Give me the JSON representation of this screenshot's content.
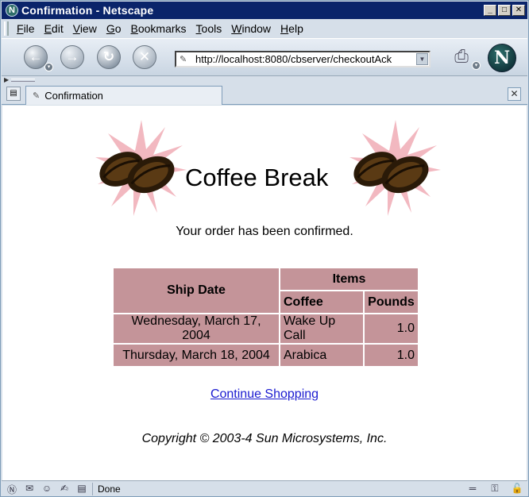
{
  "window": {
    "title": "Confirmation - Netscape",
    "controls": [
      "_",
      "□",
      "✕"
    ]
  },
  "menubar": {
    "items": [
      {
        "label": "File",
        "key": "F",
        "rest": "ile"
      },
      {
        "label": "Edit",
        "key": "E",
        "rest": "dit"
      },
      {
        "label": "View",
        "key": "V",
        "rest": "iew"
      },
      {
        "label": "Go",
        "key": "G",
        "rest": "o"
      },
      {
        "label": "Bookmarks",
        "key": "B",
        "rest": "ookmarks"
      },
      {
        "label": "Tools",
        "key": "T",
        "rest": "ools"
      },
      {
        "label": "Window",
        "key": "W",
        "rest": "indow"
      },
      {
        "label": "Help",
        "key": "H",
        "rest": "elp"
      }
    ]
  },
  "toolbar": {
    "back_icon": "back-arrow-icon",
    "forward_icon": "forward-arrow-icon",
    "reload_icon": "reload-icon",
    "stop_icon": "stop-icon",
    "url": "http://localhost:8080/cbserver/checkoutAck",
    "logo_letter": "N"
  },
  "tabs": [
    {
      "label": "Confirmation"
    }
  ],
  "page": {
    "brand_title": "Coffee Break",
    "confirm_message": "Your order has been confirmed.",
    "table": {
      "header_ship_date": "Ship Date",
      "header_items": "Items",
      "header_coffee": "Coffee",
      "header_pounds": "Pounds",
      "rows": [
        {
          "date": "Wednesday, March 17, 2004",
          "coffee": "Wake Up Call",
          "pounds": "1.0"
        },
        {
          "date": "Thursday, March 18, 2004",
          "coffee": "Arabica",
          "pounds": "1.0"
        }
      ]
    },
    "continue_link": "Continue Shopping",
    "copyright": "Copyright © 2003-4 Sun Microsystems, Inc."
  },
  "statusbar": {
    "text": "Done"
  },
  "colors": {
    "table_cell": "#c49499",
    "link": "#1a1ad0",
    "titlebar": "#0a246a"
  }
}
